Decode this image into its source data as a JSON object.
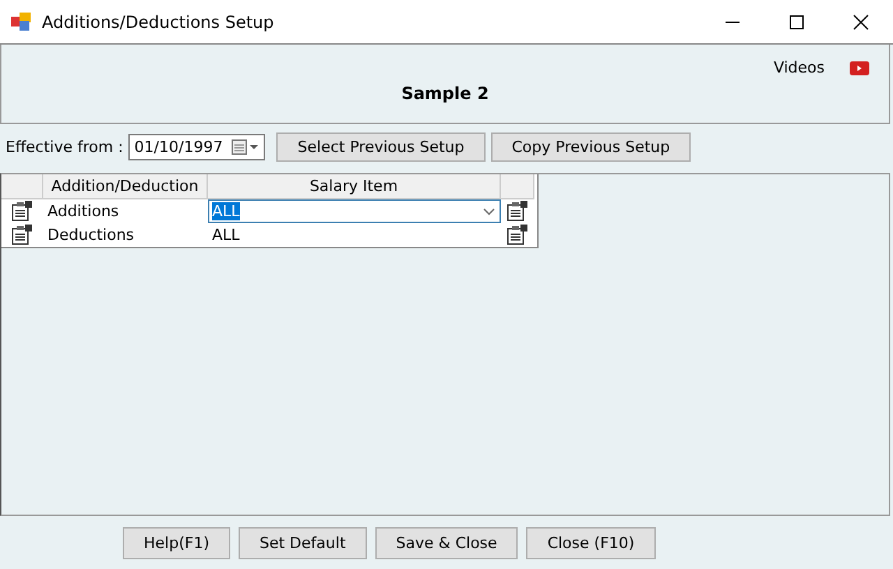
{
  "window": {
    "title": "Additions/Deductions Setup"
  },
  "header": {
    "title": "Sample 2",
    "videos_label": "Videos"
  },
  "effective": {
    "label": "Effective from :",
    "value": "01/10/1997"
  },
  "top_buttons": [
    "Select Previous Setup",
    "Copy Previous Setup"
  ],
  "table": {
    "columns": [
      "Addition/Deduction",
      "Salary Item"
    ],
    "rows": [
      {
        "name": "Additions",
        "salary_item": "ALL",
        "editing": true
      },
      {
        "name": "Deductions",
        "salary_item": "ALL",
        "editing": false
      }
    ]
  },
  "bottom_buttons": [
    "Help(F1)",
    "Set Default",
    "Save & Close",
    "Close (F10)"
  ]
}
